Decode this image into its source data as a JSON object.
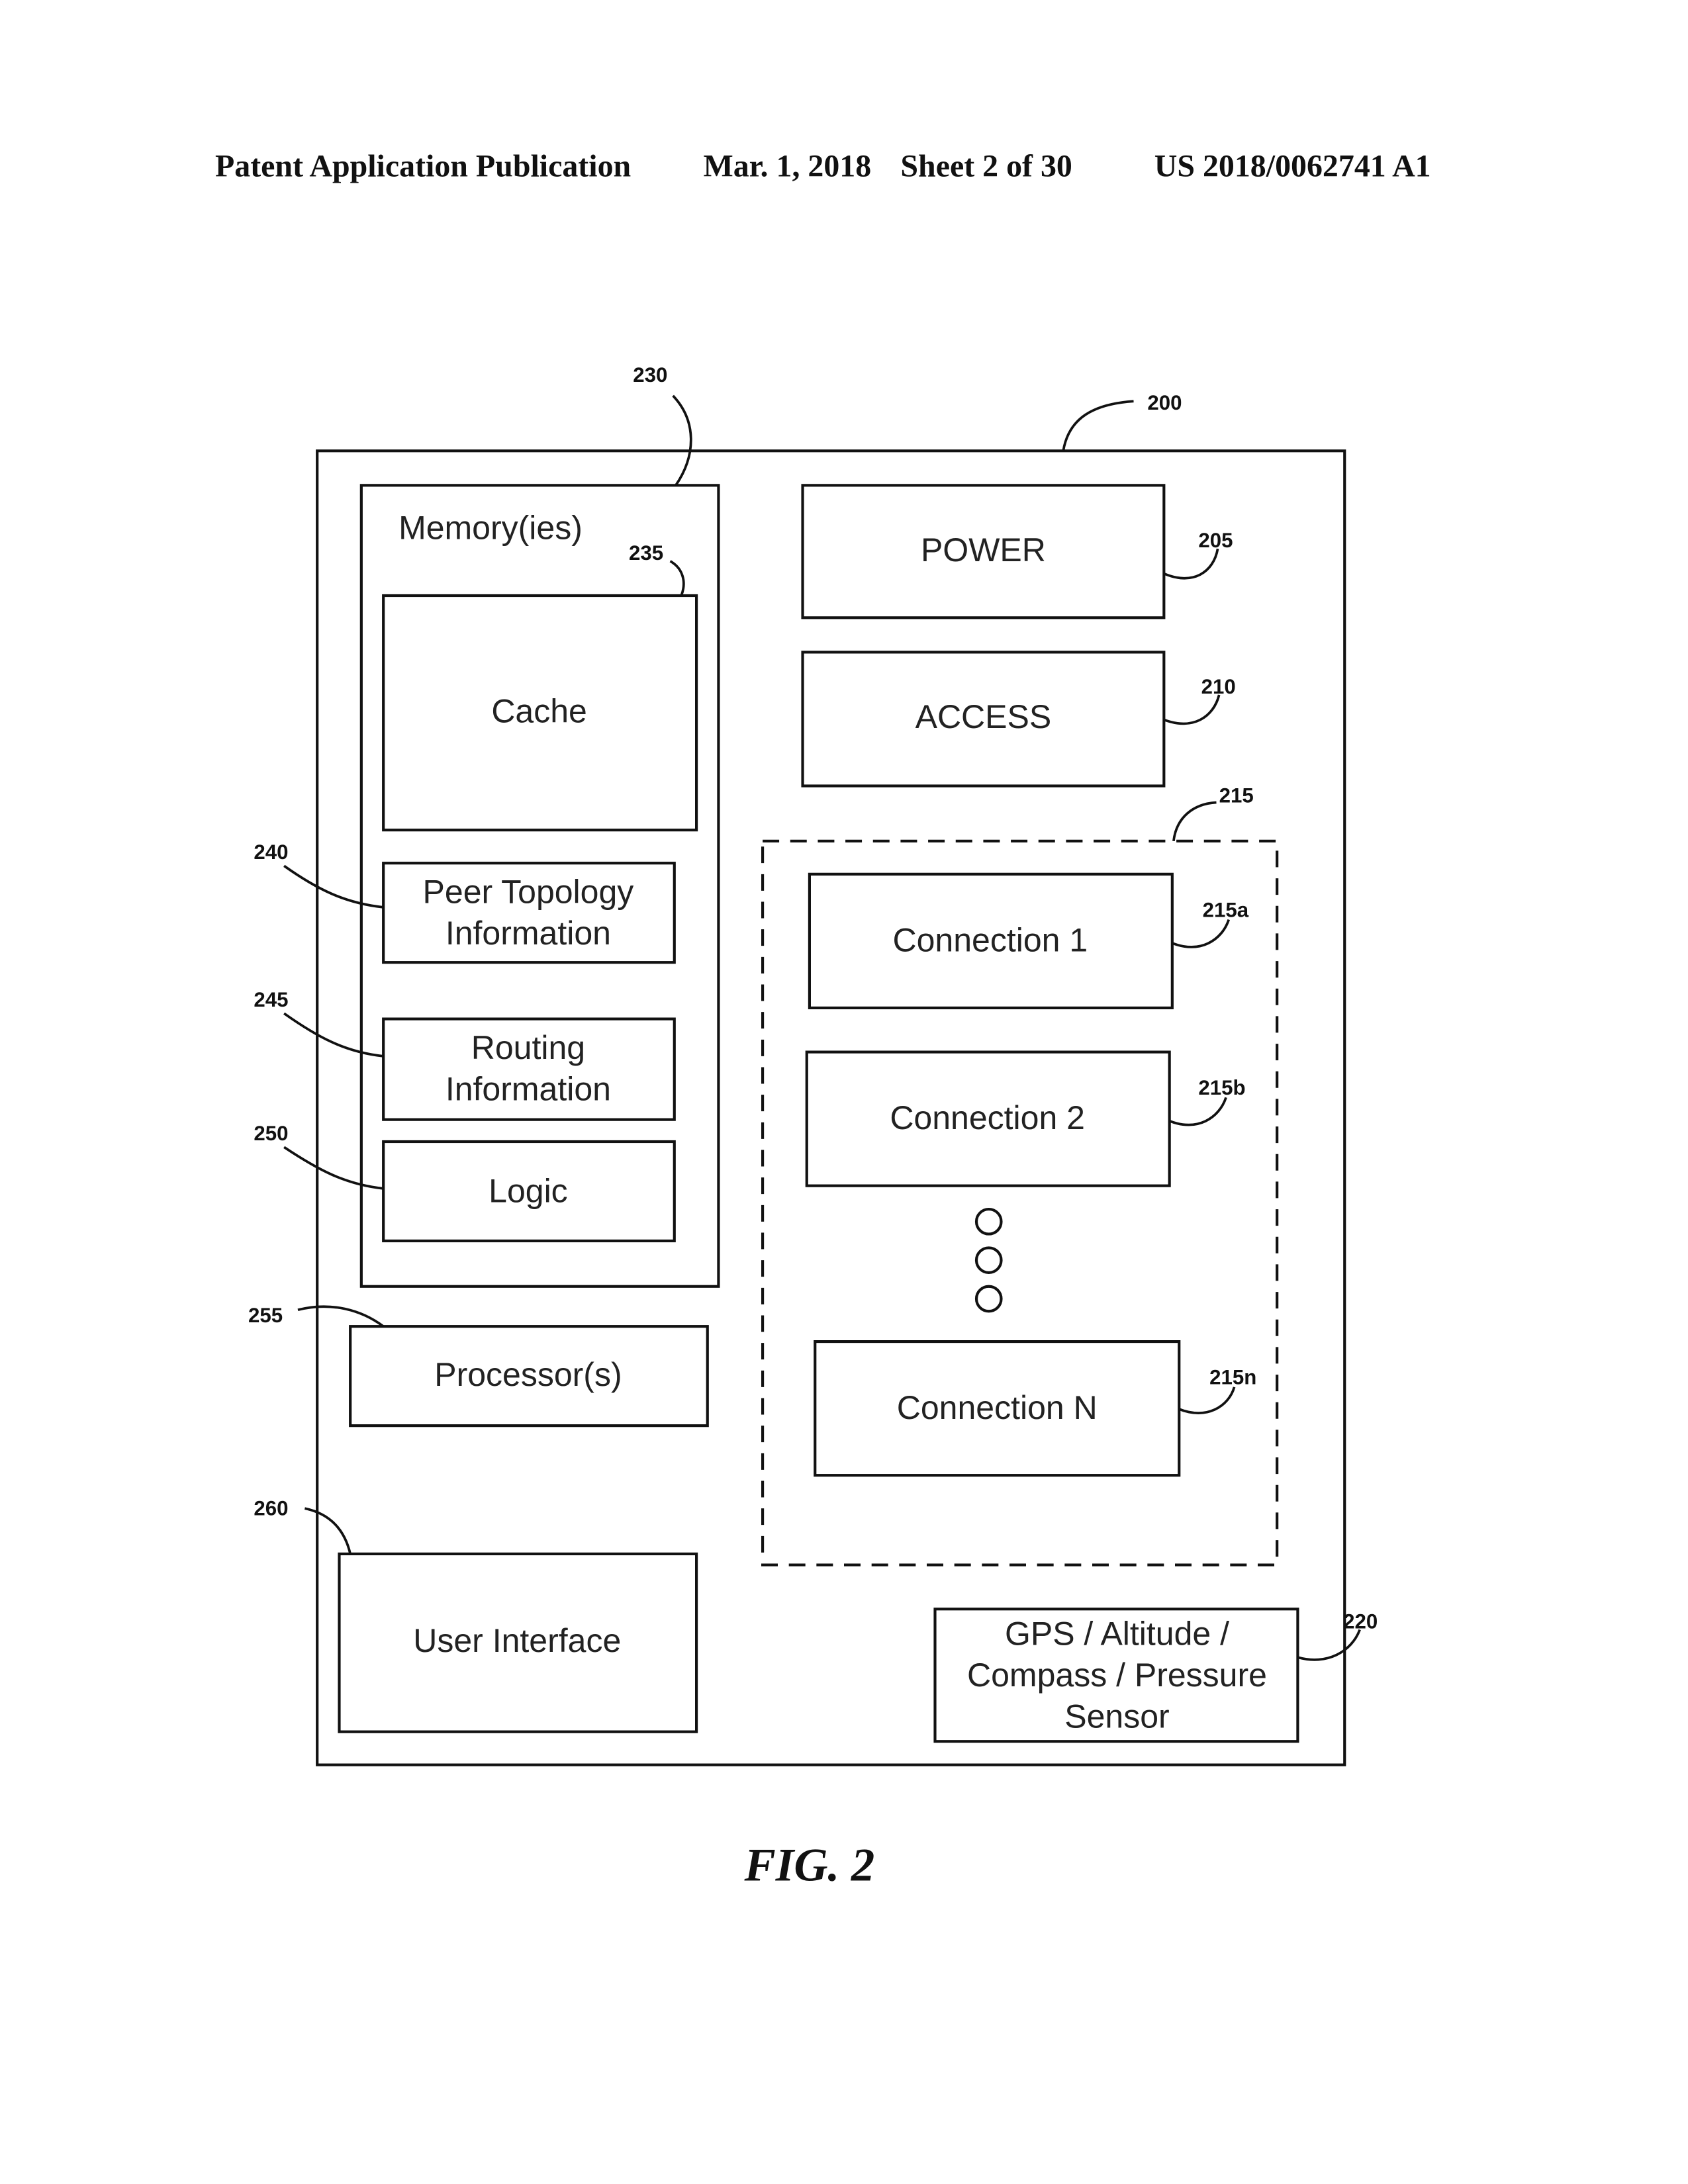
{
  "header": {
    "publication": "Patent Application Publication",
    "date": "Mar. 1, 2018",
    "sheet": "Sheet 2 of 30",
    "number": "US 2018/0062741 A1"
  },
  "figure": {
    "caption": "FIG. 2",
    "device": {
      "ref": "200"
    },
    "memory": {
      "ref": "230",
      "title": "Memory(ies)"
    },
    "cache": {
      "ref": "235",
      "label": "Cache"
    },
    "peer_topology": {
      "ref": "240",
      "lines": [
        "Peer Topology",
        "Information"
      ]
    },
    "routing": {
      "ref": "245",
      "lines": [
        "Routing",
        "Information"
      ]
    },
    "logic": {
      "ref": "250",
      "label": "Logic"
    },
    "processor": {
      "ref": "255",
      "label": "Processor(s)"
    },
    "user_interface": {
      "ref": "260",
      "label": "User Interface"
    },
    "power": {
      "ref": "205",
      "label": "POWER"
    },
    "access": {
      "ref": "210",
      "label": "ACCESS"
    },
    "connections": {
      "ref": "215",
      "items": [
        {
          "ref": "215a",
          "label": "Connection 1"
        },
        {
          "ref": "215b",
          "label": "Connection 2"
        },
        {
          "ref": "215n",
          "label": "Connection N"
        }
      ]
    },
    "sensor": {
      "ref": "220",
      "lines": [
        "GPS / Altitude /",
        "Compass / Pressure",
        "Sensor"
      ]
    }
  }
}
